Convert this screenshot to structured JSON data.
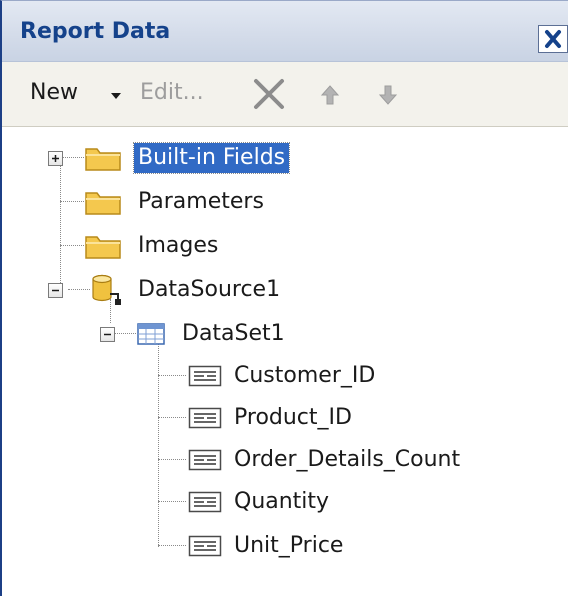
{
  "panel": {
    "title": "Report Data"
  },
  "toolbar": {
    "new_label": "New",
    "edit_label": "Edit..."
  },
  "tree": {
    "built_in_fields": "Built-in Fields",
    "parameters": "Parameters",
    "images": "Images",
    "data_source": "DataSource1",
    "data_set": "DataSet1",
    "fields": [
      "Customer_ID",
      "Product_ID",
      "Order_Details_Count",
      "Quantity",
      "Unit_Price"
    ]
  },
  "icons": {
    "folder": "folder-icon",
    "database": "database-icon",
    "dataset": "dataset-icon",
    "field": "field-icon",
    "delete": "delete-icon",
    "move_up": "arrow-up-icon",
    "move_down": "arrow-down-icon",
    "close": "close-icon"
  },
  "colors": {
    "title_text": "#15428b",
    "selection": "#316ac5",
    "folder": "#f4c84e"
  }
}
